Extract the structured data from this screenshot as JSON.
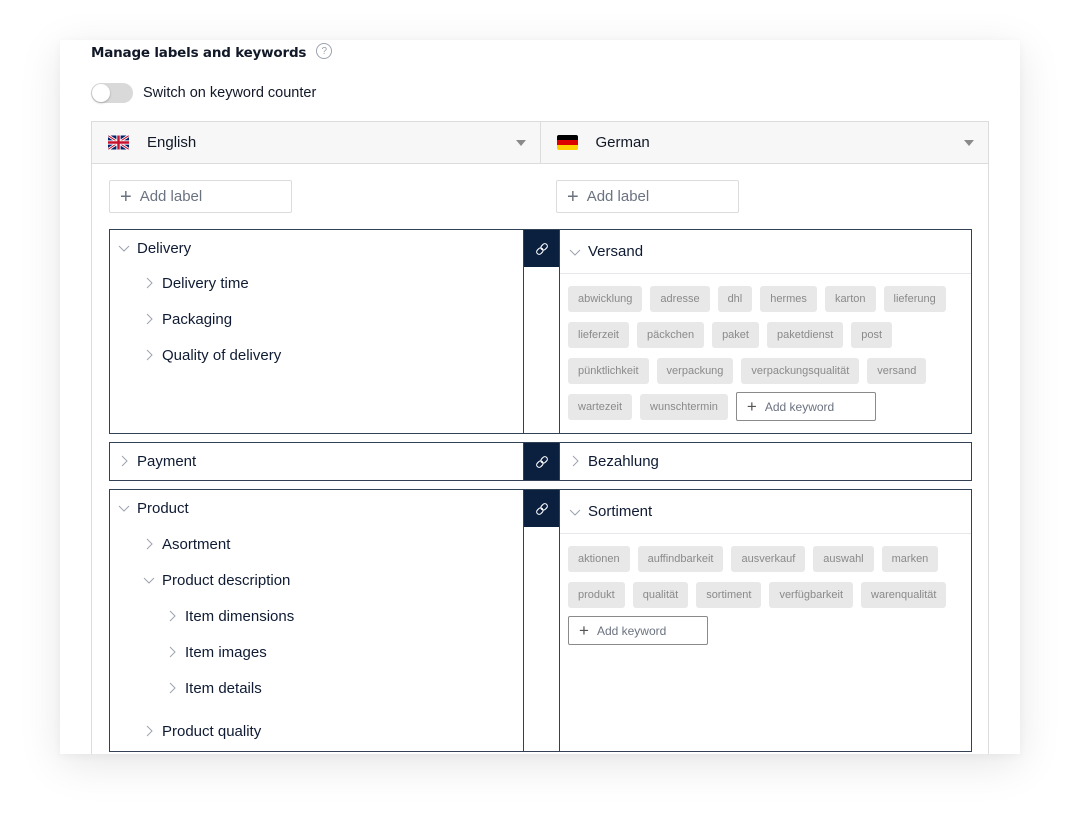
{
  "header": {
    "title": "Manage labels and keywords",
    "help_icon": "question-circle-icon"
  },
  "keyword_counter": {
    "label": "Switch on keyword counter",
    "enabled": false
  },
  "languages": {
    "left": {
      "name": "English",
      "flag": "uk-flag-icon"
    },
    "right": {
      "name": "German",
      "flag": "germany-flag-icon"
    }
  },
  "add_label": {
    "left": "Add label",
    "right": "Add label"
  },
  "add_keyword": "Add keyword",
  "colors": {
    "link_button_bg": "#0b1f3f",
    "box_border": "#334155",
    "keyword_chip_bg": "#e8e8e8",
    "keyword_chip_text": "#8a8a8a"
  },
  "groups": [
    {
      "left_label": "Delivery",
      "right_label": "Versand",
      "expanded": true,
      "children": [
        {
          "label": "Delivery time",
          "expanded": false
        },
        {
          "label": "Packaging",
          "expanded": false
        },
        {
          "label": "Quality of delivery",
          "expanded": false
        }
      ],
      "keywords": [
        "abwicklung",
        "adresse",
        "dhl",
        "hermes",
        "karton",
        "lieferung",
        "lieferzeit",
        "päckchen",
        "paket",
        "paketdienst",
        "post",
        "pünktlichkeit",
        "verpackung",
        "verpackungsqualität",
        "versand",
        "wartezeit",
        "wunschtermin"
      ]
    },
    {
      "left_label": "Payment",
      "right_label": "Bezahlung",
      "expanded": false,
      "children": [],
      "keywords": []
    },
    {
      "left_label": "Product",
      "right_label": "Sortiment",
      "expanded": true,
      "children": [
        {
          "label": "Asortment",
          "expanded": false
        },
        {
          "label": "Product description",
          "expanded": true,
          "children": [
            {
              "label": "Item dimensions"
            },
            {
              "label": "Item images"
            },
            {
              "label": "Item details"
            }
          ]
        },
        {
          "label": "Product quality",
          "expanded": false
        }
      ],
      "keywords": [
        "aktionen",
        "auffindbarkeit",
        "ausverkauf",
        "auswahl",
        "marken",
        "produkt",
        "qualität",
        "sortiment",
        "verfügbarkeit",
        "warenqualität"
      ]
    }
  ]
}
